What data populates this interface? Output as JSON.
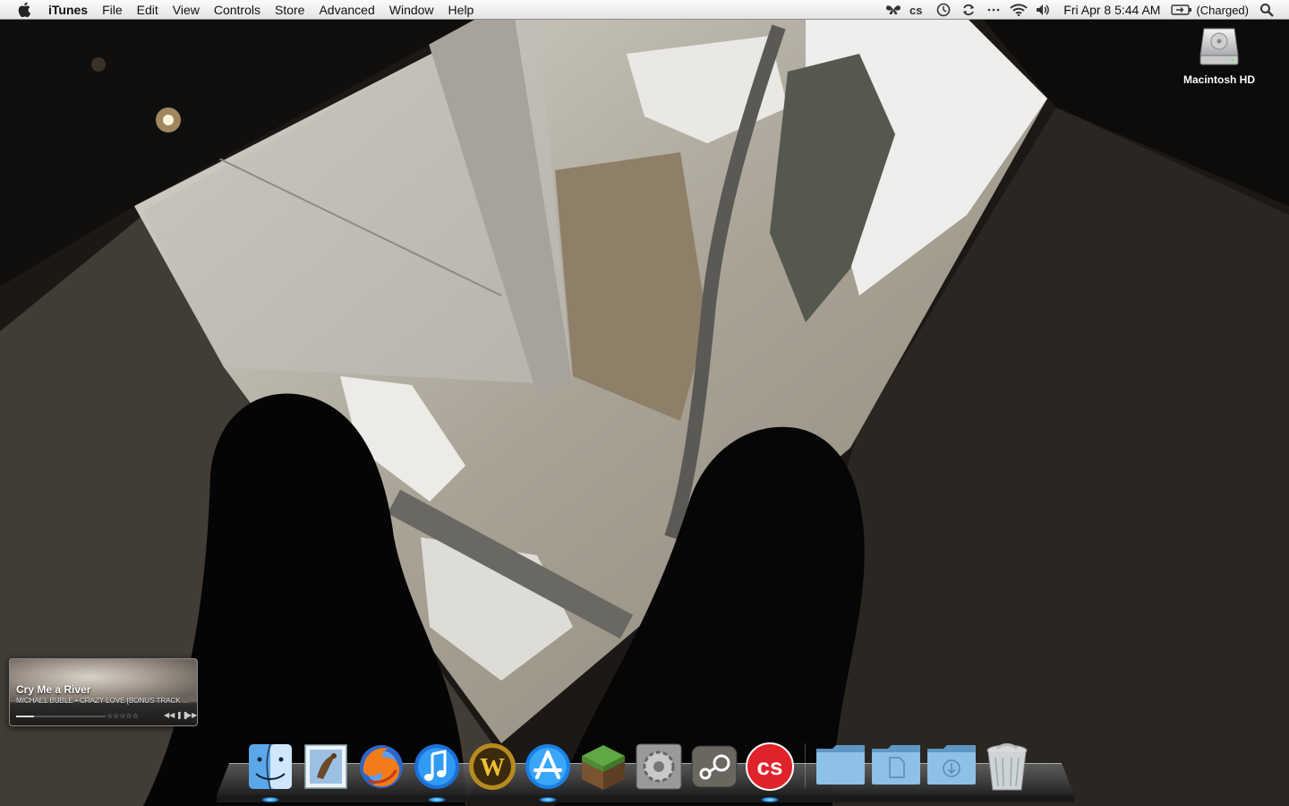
{
  "menubar": {
    "app_name": "iTunes",
    "items": [
      "File",
      "Edit",
      "View",
      "Controls",
      "Store",
      "Advanced",
      "Window",
      "Help"
    ],
    "status_icons": [
      "butterfly-icon",
      "lastfm-icon",
      "time-machine-icon",
      "sync-icon",
      "overflow-icon",
      "wifi-icon",
      "volume-icon"
    ],
    "clock": "Fri Apr 8  5:44 AM",
    "battery": "(Charged)"
  },
  "desktop": {
    "disk_label": "Macintosh HD"
  },
  "itunes_widget": {
    "track_title": "Cry Me a River",
    "track_subtitle": "MICHAEL BUBLE • CRAZY LOVE [BONUS TRACK ...",
    "rating": "☆☆☆☆☆",
    "progress": 0.2,
    "controls": [
      "previous-icon",
      "pause-icon",
      "next-icon"
    ]
  },
  "dock": {
    "apps": [
      "Finder",
      "Mail",
      "Firefox",
      "iTunes",
      "World of Warcraft",
      "App Store",
      "Minecraft",
      "System Preferences",
      "Steam",
      "Last.fm"
    ],
    "stacks": [
      "Applications",
      "Documents",
      "Downloads"
    ],
    "trash": "Trash",
    "running": [
      "Finder",
      "iTunes",
      "App Store",
      "Last.fm"
    ]
  },
  "colors": {
    "running_indicator": "#2f9cff",
    "lastfm_red": "#e0222a",
    "folder_blue": "#7cb1d8"
  }
}
